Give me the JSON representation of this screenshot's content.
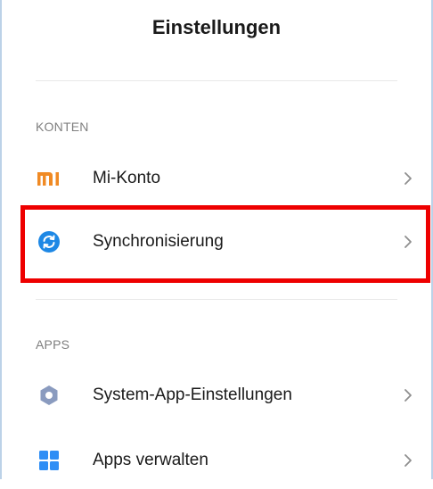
{
  "header": {
    "title": "Einstellungen"
  },
  "sections": [
    {
      "header": "KONTEN",
      "items": [
        {
          "label": "Mi-Konto",
          "icon": "mi-logo-icon",
          "icon_color": "#f08a24"
        },
        {
          "label": "Synchronisierung",
          "icon": "sync-icon",
          "icon_color": "#1e88e5",
          "highlighted": true
        }
      ]
    },
    {
      "header": "APPS",
      "items": [
        {
          "label": "System-App-Einstellungen",
          "icon": "gear-icon",
          "icon_color": "#8a9bbf"
        },
        {
          "label": "Apps verwalten",
          "icon": "apps-grid-icon",
          "icon_color": "#2f8ef5"
        }
      ]
    }
  ],
  "mi_logo_text": "mi",
  "highlight_color": "#ee0000"
}
